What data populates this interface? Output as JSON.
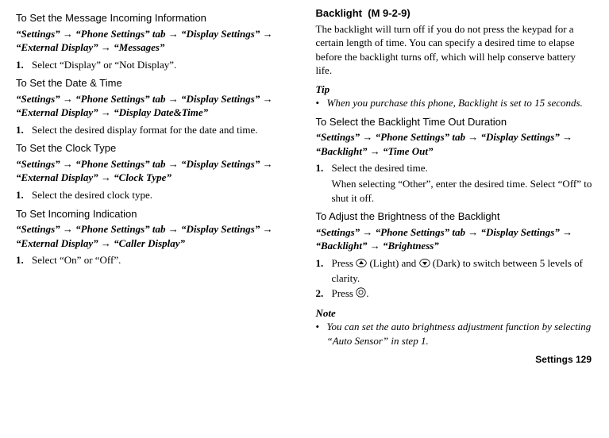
{
  "left": {
    "s1": {
      "title": "To Set the Message Incoming Information",
      "path": "“Settings” → “Phone Settings” tab → “Display Settings” → “External Display” → “Messages”",
      "step1_num": "1.",
      "step1_text": "Select “Display” or “Not Display”."
    },
    "s2": {
      "title": "To Set the Date & Time",
      "path": "“Settings” → “Phone Settings” tab → “Display Settings” → “External Display” → “Display Date&Time”",
      "step1_num": "1.",
      "step1_text": "Select the desired display format for the date and time."
    },
    "s3": {
      "title": "To Set the Clock Type",
      "path": "“Settings” → “Phone Settings” tab → “Display Settings” → “External Display” → “Clock Type”",
      "step1_num": "1.",
      "step1_text": "Select the desired clock type."
    },
    "s4": {
      "title": "To Set Incoming Indication",
      "path": "“Settings” → “Phone Settings” tab → “Display Settings” → “External Display” → “Caller Display”",
      "step1_num": "1.",
      "step1_text": "Select “On” or “Off”."
    }
  },
  "right": {
    "backlight": {
      "title": "Backlight",
      "mcode": "(M 9-2-9)",
      "para": "The backlight will turn off if you do not press the keypad for a certain length of time. You can specify a desired time to elapse before the backlight turns off, which will help conserve battery life.",
      "tip_label": "Tip",
      "tip_bullet": "•",
      "tip_text": "When you purchase this phone, Backlight is set to 15 seconds."
    },
    "timeout": {
      "title": "To Select the Backlight Time Out Duration",
      "path": "“Settings” → “Phone Settings” tab → “Display Settings” → “Backlight” → “Time Out”",
      "step1_num": "1.",
      "step1_text": "Select the desired time.",
      "step1_sub": "When selecting “Other”, enter the desired time. Select “Off” to shut it off."
    },
    "brightness": {
      "title": "To Adjust the Brightness of the Backlight",
      "path": "“Settings” → “Phone Settings” tab → “Display Settings” → “Backlight” → “Brightness”",
      "step1_num": "1.",
      "step1_pre": "Press ",
      "step1_mid": " (Light) and ",
      "step1_post": " (Dark) to switch between 5 levels of clarity.",
      "step2_num": "2.",
      "step2_pre": "Press ",
      "step2_post": "."
    },
    "note": {
      "label": "Note",
      "bullet": "•",
      "text": "You can set the auto brightness adjustment function by selecting “Auto Sensor” in step 1."
    }
  },
  "footer": "Settings   129"
}
